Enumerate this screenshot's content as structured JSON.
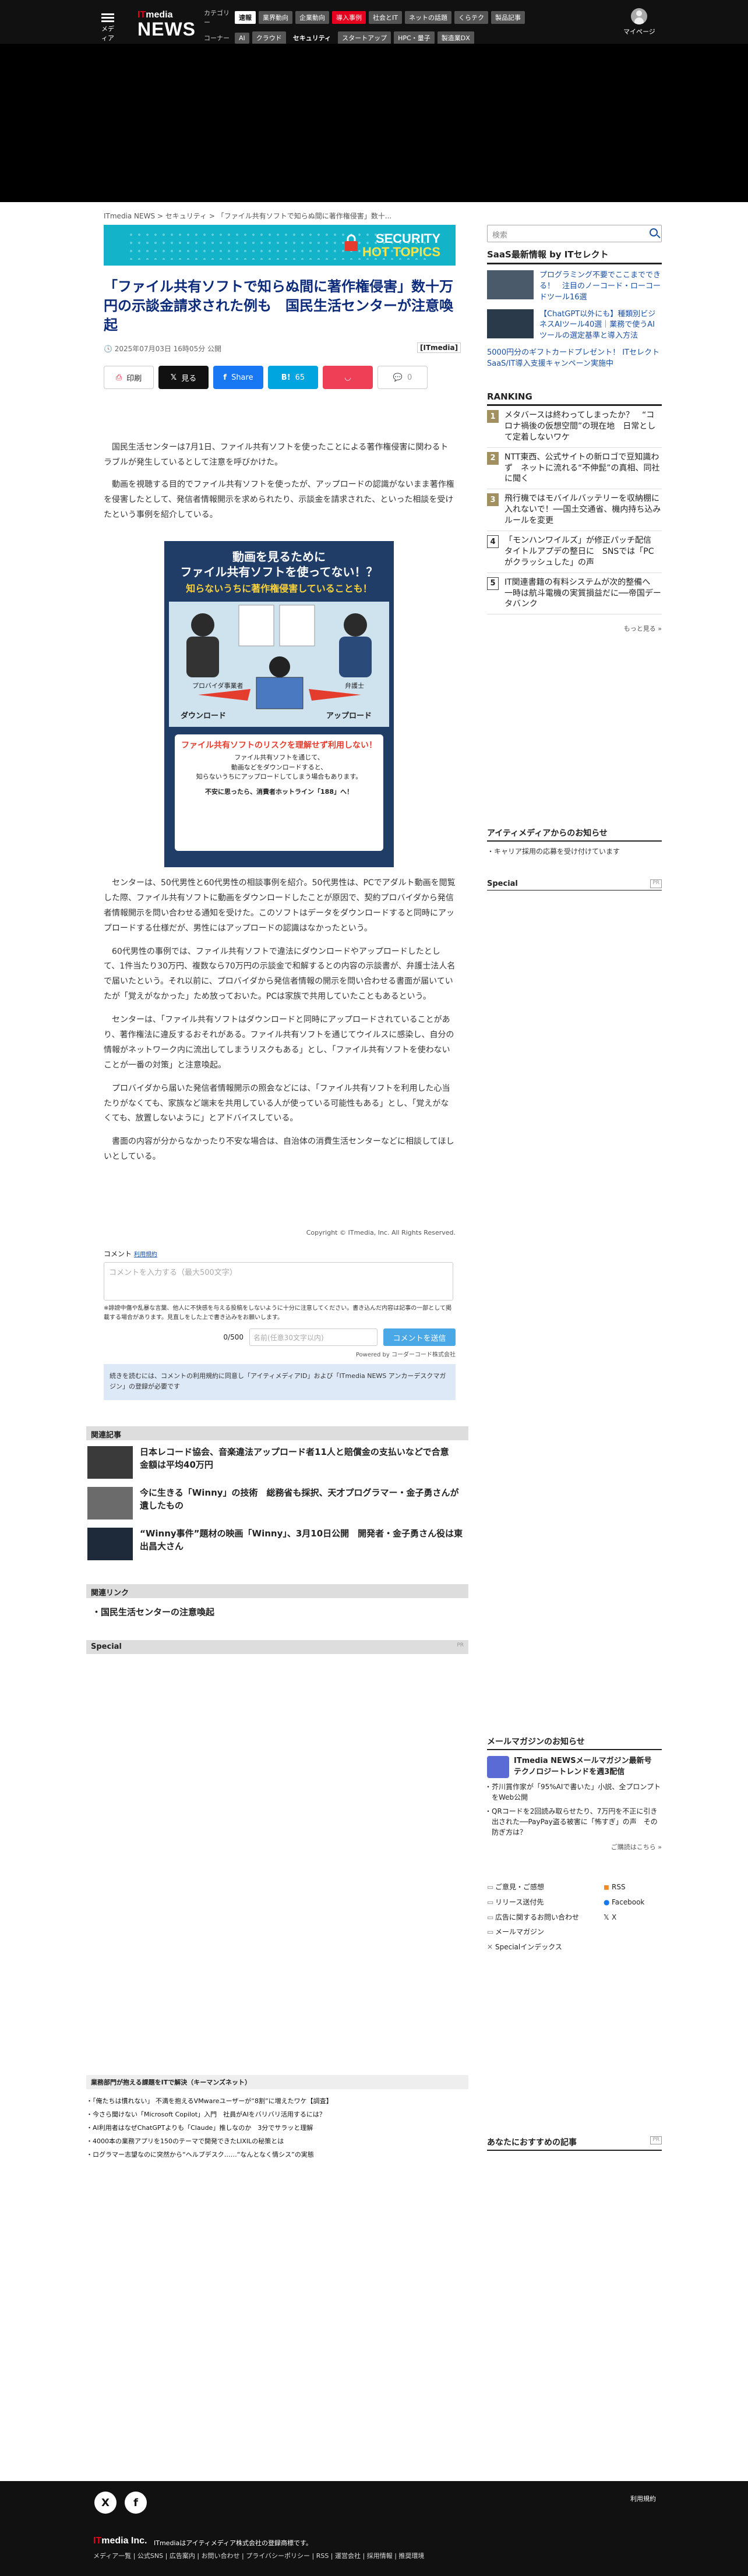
{
  "header": {
    "menu_label": "メディア",
    "logo_it": "ITmedia",
    "logo_news": "NEWS",
    "category_label": "カテゴリー",
    "categories": [
      "速報",
      "業界動向",
      "企業動向",
      "導入事例",
      "社会とIT",
      "ネットの話題",
      "くらテク",
      "製品記事"
    ],
    "corner_label": "コーナー",
    "corners": [
      "AI",
      "クラウド",
      "セキュリティ",
      "スタートアップ",
      "HPC・量子",
      "製造業DX"
    ],
    "mypage": "マイページ"
  },
  "breadcrumb": "ITmedia NEWS > セキュリティ > 「ファイル共有ソフトで知らぬ間に著作権侵害」数十...",
  "banner": {
    "line1": "SECURITY",
    "line2": "HOT TOPICS"
  },
  "article": {
    "title": "「ファイル共有ソフトで知らぬ間に著作権侵害」数十万円の示談金請求された例も　国民生活センターが注意喚起",
    "date": "2025年07月03日 16時05分 公開",
    "brand": "[ITmedia]",
    "share": {
      "print": "印刷",
      "x": "見る",
      "fb": "Share",
      "hb": "65",
      "comment": "0"
    },
    "para1": "国民生活センターは7月1日、ファイル共有ソフトを使ったことによる著作権侵害に関わるトラブルが発生しているとして注意を呼びかけた。",
    "para2": "動画を視聴する目的でファイル共有ソフトを使ったが、アップロードの認識がないまま著作権を侵害したとして、発信者情報開示を求められたり、示談金を請求された、といった相談を受けたという事例を紹介している。",
    "para3": "センターは、50代男性と60代男性の相談事例を紹介。50代男性は、PCでアダルト動画を閲覧した際、ファイル共有ソフトに動画をダウンロードしたことが原因で、契約プロバイダから発信者情報開示を問い合わせる通知を受けた。このソフトはデータをダウンロードすると同時にアップロードする仕様だが、男性にはアップロードの認識はなかったという。",
    "para4": "60代男性の事例では、ファイル共有ソフトで違法にダウンロードやアップロードしたとして、1件当たり30万円、複数なら70万円の示談金で和解するとの内容の示談書が、弁護士法人名で届いたという。それ以前に、プロバイダから発信者情報の開示を問い合わせる書面が届いていたが「覚えがなかった」ため放っておいた。PCは家族で共用していたこともあるという。",
    "para5": "センターは、「ファイル共有ソフトはダウンロードと同時にアップロードされていることがあり、著作権法に違反するおそれがある。ファイル共有ソフトを通じてウイルスに感染し、自分の情報がネットワーク内に流出してしまうリスクもある」とし、「ファイル共有ソフトを使わないことが一番の対策」と注意喚起。",
    "para6": "プロバイダから届いた発信者情報開示の照会などには、「ファイル共有ソフトを利用した心当たりがなくても、家族など端末を共用している人が使っている可能性もある」とし、「覚えがなくても、放置しないように」とアドバイスしている。",
    "para7": "書面の内容が分からなかったり不安な場合は、自治体の消費生活センターなどに相談してほしいとしている。",
    "copyright": "Copyright © ITmedia, Inc. All Rights Reserved."
  },
  "figure": {
    "h1a": "動画を見るために",
    "h1b": "ファイル共有ソフトを使ってない！？",
    "h2": "知らないうちに著作権侵害していることも！",
    "provider": "プロバイダ事業者",
    "lawyer": "弁護士",
    "down": "ダウンロード",
    "up": "アップロード",
    "w1": "ファイル共有ソフトのリスクを理解せず利用しない！",
    "w2a": "ファイル共有ソフトを通じて、",
    "w2b": "動画などをダウンロードすると、",
    "w2c": "知らないうちにアップロードしてしまう場合もあります。",
    "w3": "不安に思ったら、消費者ホットライン「188」へ！"
  },
  "comment": {
    "label": "コメント",
    "rules": "利用規約",
    "placeholder": "コメントを入力する（最大500文字）",
    "note": "※誹謗中傷や乱暴な言葉、他人に不快感を与える投稿をしないように十分に注意してください。書き込んだ内容は記事の一部として掲載する場合があります。見直しをした上で書き込みをお願いします。",
    "count": "0/500",
    "name_placeholder": "名前(任意30文字以内)",
    "send": "コメントを送信",
    "powered": "Powered by コーダーコード株式会社",
    "info": "続きを読むには、コメントの利用規約に同意し「アイティメディアID」および「ITmedia NEWS アンカーデスクマガジン」の登録が必要です"
  },
  "related": {
    "heading": "関連記事",
    "items": [
      "日本レコード協会、音楽違法アップロード者11人と賠償金の支払いなどで合意　金額は平均40万円",
      "今に生きる「Winny」の技術　総務省も採択、天才プログラマー・金子勇さんが遺したもの",
      "“Winny事件”題材の映画「Winny」、3月10日公開　開発者・金子勇さん役は東出昌大さん"
    ],
    "links_heading": "関連リンク",
    "link": "国民生活センターの注意喚起",
    "special": "Special",
    "pr": "PR"
  },
  "ad_section": {
    "heading": "業務部門が抱える課題をITで解決（キーマンズネット）",
    "items": [
      "「俺たちは慣れない」 不満を抱えるVMwareユーザーが“8割”に増えたワケ【調査】",
      "今さら聞けない「Microsoft Copilot」入門　社員がAIをバリバリ活用するには？",
      "AI利用者はなぜChatGPTよりも「Claude」推しなのか　3分でサラッと理解",
      "4000本の業務アプリを150のテーマで開発できたLIXILの秘策とは",
      "ログラマー志望なのに突然から“ヘルプデスク……“なんとなく情シス”の実態"
    ]
  },
  "sidebar": {
    "search_placeholder": "検索",
    "saas_heading": "SaaS最新情報 by ITセレクト",
    "saas_items": [
      "プログラミング不要でここまでできる！　注目のノーコード・ローコードツール16選",
      "【ChatGPT以外にも】種類別ビジネスAIツール40選｜業務で使うAIツールの選定基準と導入方法"
    ],
    "saas_promo": "5000円分のギフトカードプレゼント！ ITセレクトSaaS/IT導入支援キャンペーン実施中",
    "ranking_heading": "RANKING",
    "ranking": [
      "メタバースは終わってしまったか？　“コロナ禍後の仮想空間”の現在地　日常として定着しないワケ",
      "NTT東西、公式サイトの新ロゴで豆知識わず　ネットに流れる“不伸髭”の真相、同社に聞く",
      "飛行機ではモバイルバッテリーを収納棚に入れないで！──国土交通省、機内持ち込みルールを変更",
      "「モンハンワイルズ」が修正パッチ配信　タイトルアプデの整日に　SNSでは「PCがクラッシュした」の声",
      "IT関連書籍の有料システムが次的整備へ　一時は航斗電機の実質損益だに──帝国データバンク"
    ],
    "more": "もっと見る »",
    "pr_heading": "アイティメディアからのお知らせ",
    "pr_item": "キャリア採用の応募を受け付けています",
    "special": "Special",
    "pr_tag": "PR",
    "mm_heading": "メールマガジンのお知らせ",
    "mm_title": "ITmedia NEWSメールマガジン最新号　テクノロジートレンドを週3配信",
    "mm_items": [
      "芥川賞作家が「95%AIで書いた」小説、全プロンプトをWeb公開",
      "QRコードを2回読み取らせたり、7万円を不正に引き出された──PayPay盗る被害に「怖すぎ」の声　その防ぎ方は？"
    ],
    "mm_more": "ご購読はこちら »",
    "links": [
      "ご意見・ご感想",
      "RSS",
      "リリース送付先",
      "Facebook",
      "広告に関するお問い合わせ",
      "X",
      "メールマガジン",
      "Specialインデックス"
    ],
    "recommended_heading": "あなたにおすすめの記事",
    "pr_badge": "PR"
  },
  "footer": {
    "x": "X",
    "f": "f",
    "rss": "利用規約",
    "logo_it": "IT",
    "logo_rest": "media Inc.",
    "logo_text": "ITmediaはアイティメディア株式会社の登録商標です。",
    "links": "メディア一覧 | 公式SNS | 広告案内 | お問い合わせ | プライバシーポリシー | RSS | 運営会社 | 採用情報 | 推奨環境"
  }
}
